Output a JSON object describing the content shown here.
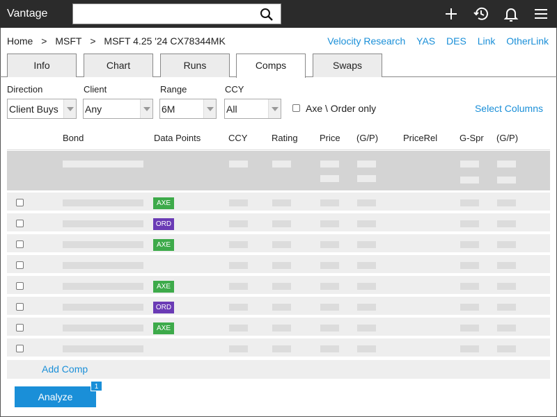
{
  "app": {
    "title": "Vantage"
  },
  "search": {
    "placeholder": "",
    "value": ""
  },
  "toolbar_icons": [
    "plus-icon",
    "history-icon",
    "bell-icon",
    "menu-icon"
  ],
  "breadcrumb": [
    "Home",
    ">",
    "MSFT",
    ">",
    "MSFT 4.25 '24 CX78344MK"
  ],
  "links": [
    "Velocity Research",
    "YAS",
    "DES",
    "Link",
    "OtherLink"
  ],
  "tabs": [
    {
      "label": "Info",
      "active": false
    },
    {
      "label": "Chart",
      "active": false
    },
    {
      "label": "Runs",
      "active": false
    },
    {
      "label": "Comps",
      "active": true
    },
    {
      "label": "Swaps",
      "active": false
    }
  ],
  "filters": {
    "direction": {
      "label": "Direction",
      "value": "Client Buys"
    },
    "client": {
      "label": "Client",
      "value": "Any"
    },
    "range": {
      "label": "Range",
      "value": "6M"
    },
    "ccy": {
      "label": "CCY",
      "value": "All"
    },
    "axe_order_only": {
      "label": "Axe \\ Order only",
      "checked": false
    },
    "select_columns": "Select Columns"
  },
  "table": {
    "columns": [
      "Bond",
      "Data Points",
      "CCY",
      "Rating",
      "Price",
      "(G/P)",
      "PriceRel",
      "G-Spr",
      "(G/P)"
    ],
    "rows": [
      {
        "checked": false,
        "badge": "AXE"
      },
      {
        "checked": false,
        "badge": "ORD"
      },
      {
        "checked": false,
        "badge": "AXE"
      },
      {
        "checked": false,
        "badge": ""
      },
      {
        "checked": false,
        "badge": "AXE"
      },
      {
        "checked": false,
        "badge": "ORD"
      },
      {
        "checked": false,
        "badge": "AXE"
      },
      {
        "checked": false,
        "badge": ""
      }
    ],
    "add_comp": "Add Comp"
  },
  "actions": {
    "analyze": "Analyze",
    "analyze_count": "1"
  },
  "colors": {
    "accent": "#1a8fd8",
    "topbar": "#2b2b2b",
    "axe": "#3daa4a",
    "ord": "#6a3bb5"
  }
}
